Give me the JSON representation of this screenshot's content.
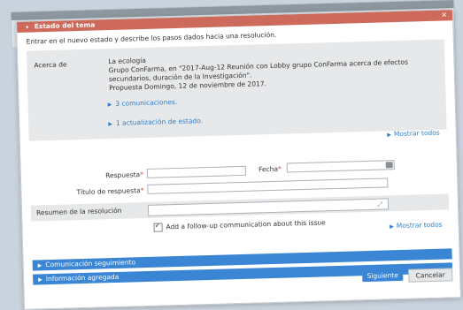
{
  "dialog": {
    "header_title": "Estado del tema",
    "instructions": "Entrar en el nuevo estado y describe los pasos dados hacia una resolución."
  },
  "info": {
    "label": "Acerca de",
    "lines": [
      "La ecología",
      "Grupo ConFarma, en \"2017-Aug-12 Reunión con Lobby grupo ConFarma acerca de efectos",
      "secundarios, duración de la Investigación\".",
      "Propuesta Domingo, 12 de noviembre de 2017."
    ],
    "link_communications": "3 comunicaciones.",
    "link_updates": "1 actualización de estado."
  },
  "show_all_1": "Mostrar todos",
  "form": {
    "respuesta_label": "Respuesta",
    "fecha_label": "Fecha",
    "titulo_label": "Título de respuesta",
    "resumen_label": "Resumen de la resolución",
    "required_mark": "*",
    "followup_label": "Add a follow-up communication about this issue",
    "followup_checked": true
  },
  "show_all_2": "Mostrar todos",
  "sections": {
    "comunicacion": "Comunicación seguimiento",
    "informacion": "Información agregada"
  },
  "buttons": {
    "next": "Siguiente",
    "cancel": "Cancelar"
  },
  "colors": {
    "header": "#cd6a5c",
    "accent": "#3a86d4",
    "link": "#2f7ec9"
  },
  "icons": [
    "chevron-down-icon",
    "triangle-right-icon",
    "calendar-icon",
    "expand-icon",
    "checkmark-icon"
  ]
}
